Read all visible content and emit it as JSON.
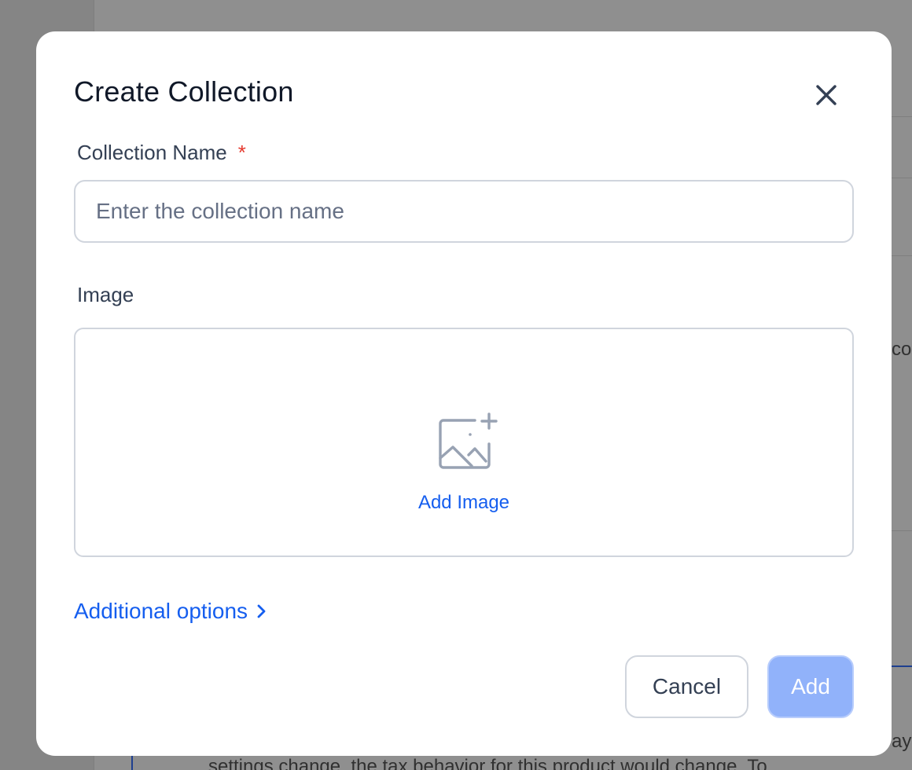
{
  "background": {
    "fragment_right_top": "co",
    "fragment_right_bottom": "ayı",
    "fragment_bottom": "settings change, the tax behavior for this product would change. To"
  },
  "modal": {
    "title": "Create Collection",
    "close_icon": "close-icon",
    "name_field": {
      "label": "Collection Name",
      "required_marker": "*",
      "placeholder": "Enter the collection name",
      "value": ""
    },
    "image_field": {
      "label": "Image",
      "icon": "image-add-icon",
      "action_label": "Add Image"
    },
    "additional_options": {
      "label": "Additional options",
      "icon": "chevron-right-icon"
    },
    "buttons": {
      "cancel_label": "Cancel",
      "add_label": "Add"
    }
  },
  "colors": {
    "accent": "#155eef",
    "disabled_primary": "#91b2fa",
    "required": "#e5382d",
    "border": "#d0d5dd",
    "overlay": "#8f8f8f"
  }
}
